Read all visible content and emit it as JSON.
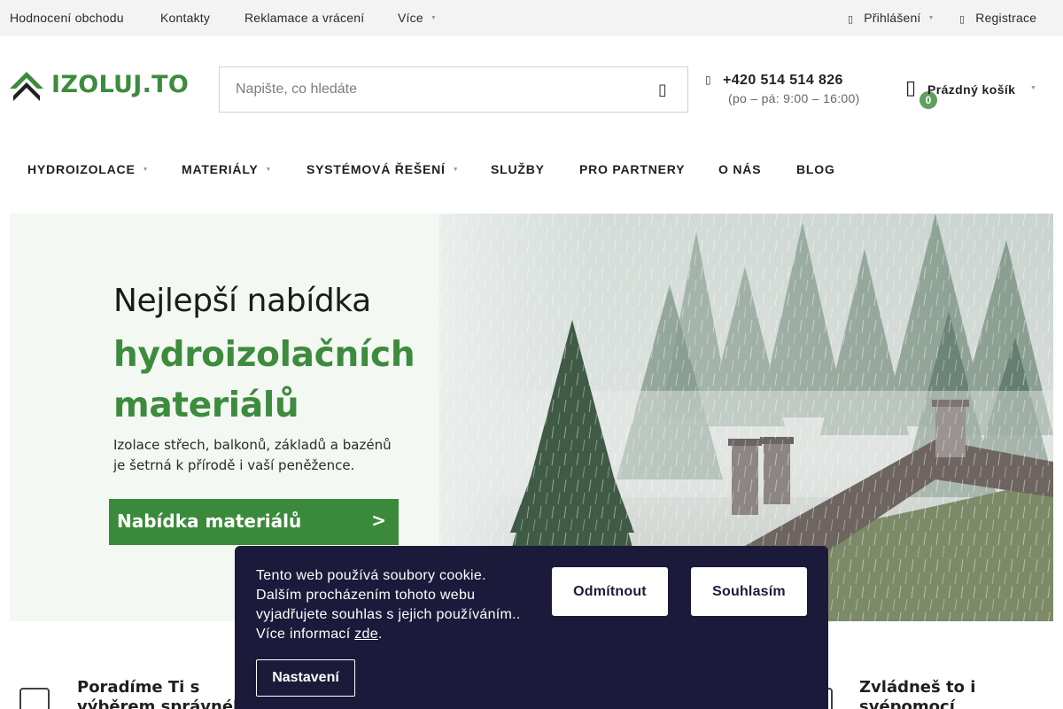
{
  "topbar": {
    "links": [
      "Hodnocení obchodu",
      "Kontakty",
      "Reklamace a vrácení"
    ],
    "more": "Více",
    "login": "Přihlášení",
    "register": "Registrace"
  },
  "header": {
    "logo_text": "IZOLUJ.TO",
    "search_placeholder": "Napište, co hledáte",
    "phone": "+420 514 514 826",
    "phone_hours": "(po – pá: 9:00 – 16:00)",
    "cart_count": "0",
    "cart_label": "Prázdný košík"
  },
  "nav": {
    "items": [
      "HYDROIZOLACE",
      "MATERIÁLY",
      "SYSTÉMOVÁ ŘEŠENÍ",
      "SLUŽBY",
      "PRO PARTNERY",
      "O NÁS",
      "BLOG"
    ]
  },
  "hero": {
    "line1": "Nejlepší nabídka",
    "line2": "hydroizolačních",
    "line3": "materiálů",
    "sub1": "Izolace střech, balkonů, základů a bazénů",
    "sub2": "je šetrná k přírodě i vaší peněžence.",
    "cta": "Nabídka materiálů",
    "cta_arrow": ">"
  },
  "features": {
    "f1_line1": "Poradíme Ti s",
    "f1_line2": "výběrem správného",
    "f2_line1": "Zvládneš to i",
    "f2_line2": "svépomocí"
  },
  "cookie": {
    "text": "Tento web používá soubory cookie. Dalším procházením tohoto webu vyjadřujete souhlas s jejich používáním.. Více informací",
    "link": "zde",
    "period": ".",
    "decline": "Odmítnout",
    "accept": "Souhlasím",
    "settings": "Nastavení"
  },
  "colors": {
    "brand_green": "#3d8b3d",
    "cookie_bg": "#1b1a3a",
    "topbar_bg": "#f3f3f3"
  }
}
